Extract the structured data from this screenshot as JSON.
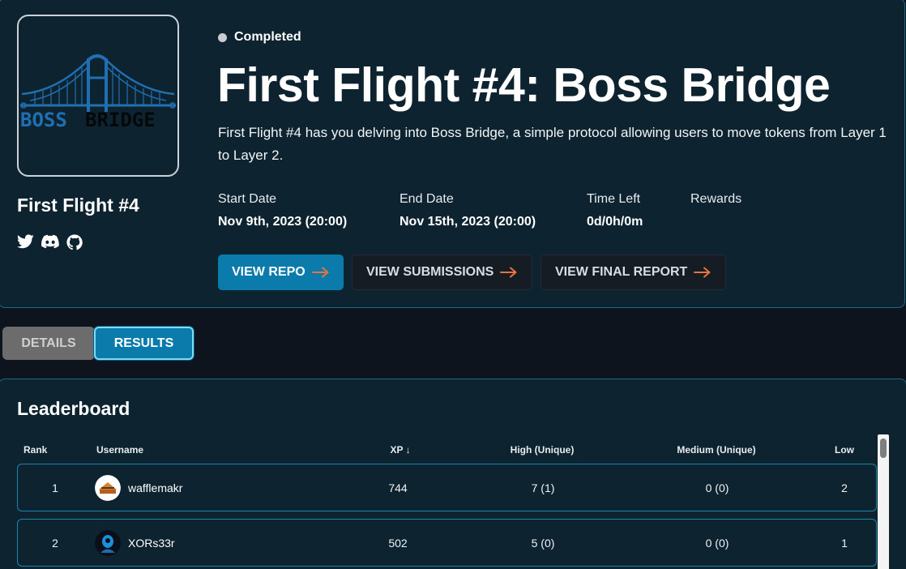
{
  "project": {
    "name": "First Flight #4",
    "logo_text_left": "BOSS",
    "logo_text_right": "BRIDGE",
    "socials": [
      "twitter-icon",
      "discord-icon",
      "github-icon"
    ]
  },
  "status": "Completed",
  "title": "First Flight #4: Boss Bridge",
  "description": "First Flight #4 has you delving into Boss Bridge, a simple protocol allowing users to move tokens from Layer 1 to Layer 2.",
  "meta": {
    "start_label": "Start Date",
    "start_value": "Nov 9th, 2023 (20:00)",
    "end_label": "End Date",
    "end_value": "Nov 15th, 2023 (20:00)",
    "time_label": "Time Left",
    "time_value": "0d/0h/0m",
    "rewards_label": "Rewards",
    "rewards_value": ""
  },
  "buttons": {
    "repo": "VIEW REPO",
    "submissions": "VIEW SUBMISSIONS",
    "report": "VIEW FINAL REPORT"
  },
  "tabs": {
    "details": "DETAILS",
    "results": "RESULTS",
    "active": "results"
  },
  "leaderboard": {
    "title": "Leaderboard",
    "columns": {
      "rank": "Rank",
      "username": "Username",
      "xp": "XP ↓",
      "high": "High (Unique)",
      "medium": "Medium (Unique)",
      "low": "Low"
    },
    "rows": [
      {
        "rank": "1",
        "username": "wafflemakr",
        "xp": "744",
        "high": "7 (1)",
        "medium": "0 (0)",
        "low": "2"
      },
      {
        "rank": "2",
        "username": "XORs33r",
        "xp": "502",
        "high": "5 (0)",
        "medium": "0 (0)",
        "low": "1"
      }
    ]
  },
  "colors": {
    "card_bg": "#0d2430",
    "card_border": "#1b6a86",
    "accent": "#0b7bab",
    "arrow": "#e9733f",
    "page_bg": "#0d141d"
  }
}
